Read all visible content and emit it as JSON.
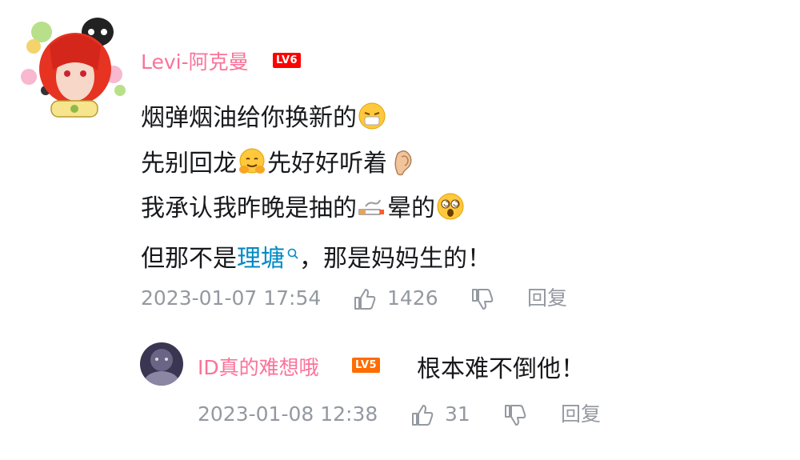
{
  "comment": {
    "username": "Levi-阿克曼",
    "level_badge": "LV6",
    "lines": {
      "l1": {
        "text": "烟弹烟油给你换新的"
      },
      "l2": {
        "text_a": "先别回龙",
        "text_b": "先好好听着"
      },
      "l3": {
        "text_a": "我承认我昨晚是抽的",
        "text_b": "晕的"
      },
      "l4": {
        "text_a": "但那不是",
        "link": "理塘",
        "text_b": "，那是妈妈生的！"
      }
    },
    "emojis": [
      "mask-face-emoji",
      "hugging-face-emoji",
      "ear-emoji",
      "cigarette-emoji",
      "dizzy-face-emoji"
    ],
    "timestamp": "2023-01-07 17:54",
    "likes": "1426",
    "reply_label": "回复"
  },
  "reply": {
    "username": "ID真的难想哦",
    "level_badge": "LV5",
    "text": "根本难不倒他！",
    "timestamp": "2023-01-08 12:38",
    "likes": "31",
    "reply_label": "回复"
  },
  "colors": {
    "username": "#fb7299",
    "meta": "#9499a0",
    "link": "#008ac5",
    "lv5": "#ff6c00",
    "lv6": "#ff0000"
  }
}
